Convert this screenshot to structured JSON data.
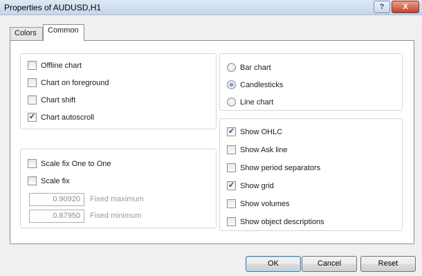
{
  "window": {
    "title": "Properties of AUDUSD,H1",
    "help_label": "?",
    "close_label": "X"
  },
  "tabs": [
    {
      "label": "Colors",
      "active": false
    },
    {
      "label": "Common",
      "active": true
    }
  ],
  "chart_options": [
    {
      "label": "Offline chart",
      "checked": false
    },
    {
      "label": "Chart on foreground",
      "checked": false
    },
    {
      "label": "Chart shift",
      "checked": false
    },
    {
      "label": "Chart autoscroll",
      "checked": true
    }
  ],
  "scale": {
    "options": [
      {
        "label": "Scale fix One to One",
        "checked": false
      },
      {
        "label": "Scale fix",
        "checked": false
      }
    ],
    "fixed_maximum": {
      "value": "0.90920",
      "label": "Fixed maximum"
    },
    "fixed_minimum": {
      "value": "0.87950",
      "label": "Fixed minimum"
    }
  },
  "chart_type": {
    "options": [
      "Bar chart",
      "Candlesticks",
      "Line chart"
    ],
    "selected": "Candlesticks"
  },
  "display_options": [
    {
      "label": "Show OHLC",
      "checked": true
    },
    {
      "label": "Show Ask line",
      "checked": false
    },
    {
      "label": "Show period separators",
      "checked": false
    },
    {
      "label": "Show grid",
      "checked": true
    },
    {
      "label": "Show volumes",
      "checked": false
    },
    {
      "label": "Show object descriptions",
      "checked": false
    }
  ],
  "buttons": {
    "ok": "OK",
    "cancel": "Cancel",
    "reset": "Reset"
  }
}
